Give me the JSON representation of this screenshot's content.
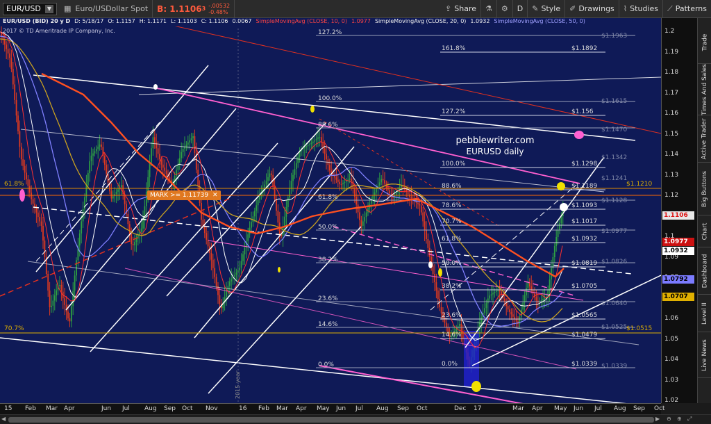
{
  "toolbar": {
    "symbol": "EUR/USD",
    "description": "Euro/USDollar Spot",
    "bid_label": "B: 1.1106",
    "bid_sub": "3",
    "change_abs": "-.00532",
    "change_pct": "-0.48%",
    "share": "Share",
    "interval": "D",
    "style": "Style",
    "drawings": "Drawings",
    "studies": "Studies",
    "patterns": "Patterns"
  },
  "study_header": {
    "title": "EUR/USD (BID) 20 y D",
    "date": "D: 5/18/17",
    "open": "O: 1.1157",
    "high": "H: 1.1171",
    "low": "L: 1.1103",
    "close": "C: 1.1106",
    "change": "0.0067",
    "sma10": "SimpleMovingAvg (CLOSE, 10, 0)",
    "sma10_val": "1.0977",
    "sma20": "SimpleMovingAvg (CLOSE, 20, 0)",
    "sma20_val": "1.0932",
    "sma50": "SimpleMovingAvg (CLOSE, 50, 0)",
    "copyright": "2017 © TD Ameritrade IP Company, Inc."
  },
  "watermark": {
    "line1": "pebblewriter.com",
    "line2": "EURUSD daily"
  },
  "mark_label": "MARK >= 1.11739",
  "year_divider": "2015 year",
  "fib_left": {
    "levels": [
      "127.2%",
      "100.0%",
      "88.6%",
      "61.8%",
      "50.0%",
      "38.2%",
      "23.6%",
      "14.6%",
      "0.0%"
    ]
  },
  "fib_main": {
    "levels": [
      {
        "pct": "161.8%",
        "price": "$1.1892"
      },
      {
        "pct": "127.2%",
        "price": "$1.156"
      },
      {
        "pct": "100.0%",
        "price": "$1.1298"
      },
      {
        "pct": "88.6%",
        "price": "$1.1189"
      },
      {
        "pct": "78.6%",
        "price": "$1.1093"
      },
      {
        "pct": "70.7%",
        "price": "$1.1017"
      },
      {
        "pct": "61.8%",
        "price": "$1.0932"
      },
      {
        "pct": "50.0%",
        "price": "$1.0819"
      },
      {
        "pct": "38.2%",
        "price": "$1.0705"
      },
      {
        "pct": "23.6%",
        "price": "$1.0565"
      },
      {
        "pct": "14.6%",
        "price": "$1.0479"
      },
      {
        "pct": "0.0%",
        "price": "$1.0339"
      }
    ]
  },
  "fib_ghost": [
    "$1.1963",
    "$1.1615",
    "$1.1470",
    "$1.1342",
    "$1.1241",
    "$1.1128",
    "$1.0977",
    "$1.0826",
    "$1.0640",
    "$1.0525",
    "$1.0339"
  ],
  "left_labels": {
    "l618": "61.8%",
    "l707": "70.7%"
  },
  "horizontal_tags": {
    "h1": "$1.1210",
    "h2": "$1.0515"
  },
  "price_axis": {
    "ticks": [
      "1.2",
      "1.19",
      "1.18",
      "1.17",
      "1.16",
      "1.15",
      "1.14",
      "1.13",
      "1.12",
      "1.11",
      "1.1",
      "1.09",
      "1.08",
      "1.07",
      "1.06",
      "1.05",
      "1.04",
      "1.03",
      "1.02"
    ],
    "tags": [
      {
        "text": "1.1106",
        "bg": "#e8e8e8",
        "fg": "#d11",
        "label": "last"
      },
      {
        "text": "1.0977",
        "bg": "#cc1111",
        "fg": "#fff",
        "label": "sma10"
      },
      {
        "text": "1.0932",
        "bg": "#ffffff",
        "fg": "#000",
        "label": "sma20"
      },
      {
        "text": "1.0792",
        "bg": "#7b7bff",
        "fg": "#000",
        "label": "sma50"
      },
      {
        "text": "1.0707",
        "bg": "#e0b000",
        "fg": "#000",
        "label": "sma100"
      }
    ]
  },
  "time_axis": {
    "labels": [
      "15",
      "Feb",
      "Mar",
      "Apr",
      "Jun",
      "Jul",
      "Aug",
      "Sep",
      "Oct",
      "Nov",
      "16",
      "Feb",
      "Mar",
      "Apr",
      "May",
      "Jun",
      "Jul",
      "Aug",
      "Sep",
      "Oct",
      "Dec",
      "17",
      "Mar",
      "Apr",
      "May",
      "Jun",
      "Jul",
      "Aug",
      "Sep",
      "Oct"
    ]
  },
  "side_tabs": [
    "Trade",
    "Times And Sales",
    "Active Trader",
    "Big Buttons",
    "Chart",
    "Dashboard",
    "Level II",
    "Live News"
  ],
  "colors": {
    "chart_bg": "#0f1a57",
    "up": "#2ea043",
    "down": "#e03a1e",
    "sma10": "#ff4444",
    "sma20": "#ffffff",
    "sma50": "#8080ff",
    "sma100": "#d0a020",
    "ema": "#ff5020",
    "magenta": "#ff60d0",
    "fib": "#9aa0b8"
  }
}
